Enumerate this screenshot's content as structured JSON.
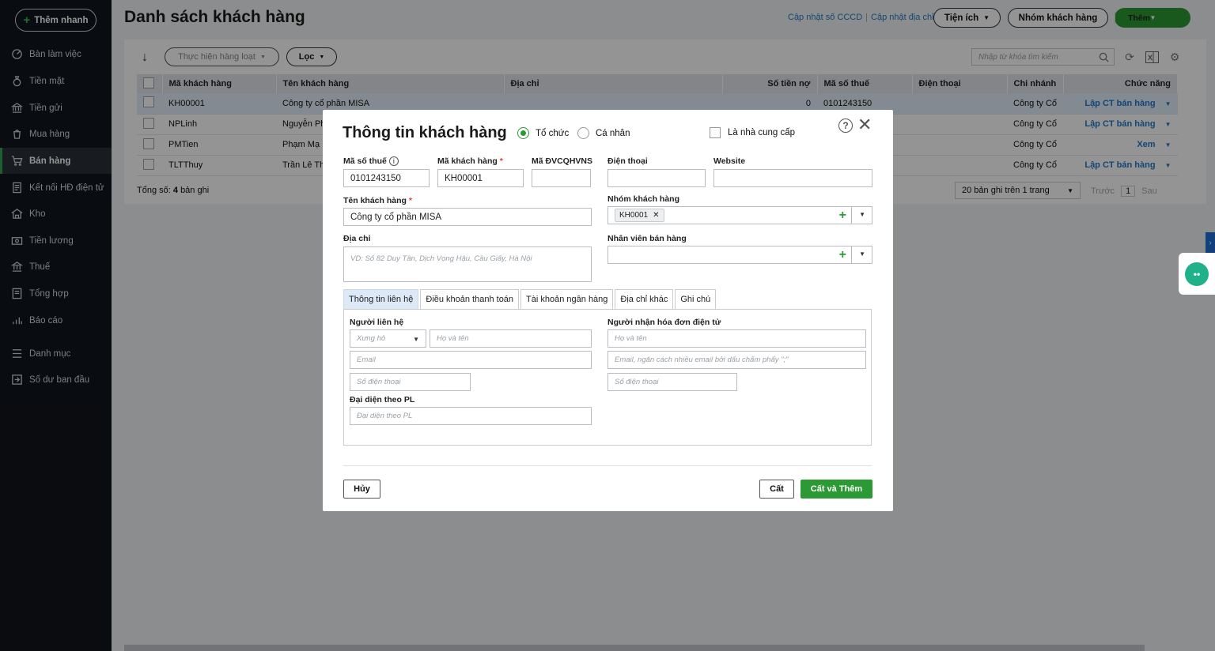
{
  "sidebar": {
    "quick_add": "Thêm nhanh",
    "items": [
      {
        "label": "Bàn làm việc",
        "icon": "dashboard-icon"
      },
      {
        "label": "Tiền mặt",
        "icon": "cash-icon"
      },
      {
        "label": "Tiền gửi",
        "icon": "bank-icon"
      },
      {
        "label": "Mua hàng",
        "icon": "purchase-icon"
      },
      {
        "label": "Bán hàng",
        "icon": "cart-icon",
        "active": true
      },
      {
        "label": "Kết nối HĐ điện tử",
        "icon": "e-invoice-icon"
      },
      {
        "label": "Kho",
        "icon": "warehouse-icon"
      },
      {
        "label": "Tiền lương",
        "icon": "salary-icon"
      },
      {
        "label": "Thuế",
        "icon": "tax-icon"
      },
      {
        "label": "Tổng hợp",
        "icon": "summary-icon"
      },
      {
        "label": "Báo cáo",
        "icon": "report-icon"
      },
      {
        "label": "Danh mục",
        "icon": "list-icon"
      },
      {
        "label": "Số dư ban đầu",
        "icon": "opening-balance-icon"
      }
    ]
  },
  "header": {
    "title": "Danh sách khách hàng",
    "link_cccd": "Cập nhật số CCCD",
    "link_sep": "|",
    "link_address": "Cập nhật địa chỉ",
    "utilities": "Tiện ích",
    "customer_group": "Nhóm khách hàng",
    "add": "Thêm"
  },
  "toolbar": {
    "batch": "Thực hiện hàng loạt",
    "filter": "Lọc",
    "search_placeholder": "Nhập từ khóa tìm kiếm"
  },
  "table": {
    "columns": [
      "Mã khách hàng",
      "Tên khách hàng",
      "Địa chỉ",
      "Số tiền nợ",
      "Mã số thuế",
      "Điện thoại",
      "Chi nhánh",
      "Chức năng"
    ],
    "rows": [
      {
        "code": "KH00001",
        "name": "Công ty cổ phần MISA",
        "address": "",
        "debt": "0",
        "tax": "0101243150",
        "phone": "",
        "branch": "Công ty Cổ",
        "action": "Lập CT bán hàng"
      },
      {
        "code": "NPLinh",
        "name": "Nguyễn Ph",
        "address": "",
        "debt": "",
        "tax": "",
        "phone": "",
        "branch": "Công ty Cổ",
        "action": "Lập CT bán hàng"
      },
      {
        "code": "PMTien",
        "name": "Phạm Mạ",
        "address": "",
        "debt": "",
        "tax": "",
        "phone": "",
        "branch": "Công ty Cổ",
        "action": "Xem"
      },
      {
        "code": "TLTThuy",
        "name": "Trần Lê Th",
        "address": "",
        "debt": "",
        "tax": "",
        "phone": "",
        "branch": "Công ty Cổ",
        "action": "Lập CT bán hàng"
      }
    ],
    "total_label": "Tổng số:",
    "total_count": "4",
    "total_suffix": "bản ghi",
    "page_size": "20 bản ghi trên 1 trang",
    "prev": "Trước",
    "page": "1",
    "next": "Sau"
  },
  "dialog": {
    "title": "Thông tin khách hàng",
    "type_org": "Tổ chức",
    "type_person": "Cá nhân",
    "is_supplier": "Là nhà cung cấp",
    "labels": {
      "tax_code": "Mã số thuế",
      "customer_code": "Mã khách hàng",
      "budget_code": "Mã ĐVCQHVNS",
      "phone": "Điện thoại",
      "website": "Website",
      "customer_name": "Tên khách hàng",
      "customer_group": "Nhóm khách hàng",
      "address": "Địa chỉ",
      "sales_staff": "Nhân viên bán hàng"
    },
    "values": {
      "tax_code": "0101243150",
      "customer_code": "KH00001",
      "customer_name": "Công ty cổ phần MISA",
      "group_tag": "KH0001"
    },
    "address_placeholder": "VD: Số 82 Duy Tân, Dịch Vọng Hậu, Cầu Giấy, Hà Nội",
    "tabs": [
      "Thông tin liên hệ",
      "Điều khoản thanh toán",
      "Tài khoản ngân hàng",
      "Địa chỉ khác",
      "Ghi chú"
    ],
    "contact": {
      "section": "Người liên hệ",
      "salutation": "Xưng hô",
      "name": "Họ và tên",
      "email": "Email",
      "phone": "Số điện thoại",
      "legal_rep": "Đại diện theo PL",
      "legal_rep_ph": "Đại diện theo PL"
    },
    "einvoice": {
      "section": "Người nhận hóa đơn điện tử",
      "name": "Họ và tên",
      "email": "Email, ngăn cách nhiều email bởi dấu chấm phẩy \";\"",
      "phone": "Số điện thoại"
    },
    "buttons": {
      "cancel": "Hủy",
      "save": "Cất",
      "save_add": "Cất và Thêm"
    }
  },
  "colors": {
    "accent": "#2b9a35",
    "link": "#2479c9",
    "sidebar": "#11151c"
  }
}
